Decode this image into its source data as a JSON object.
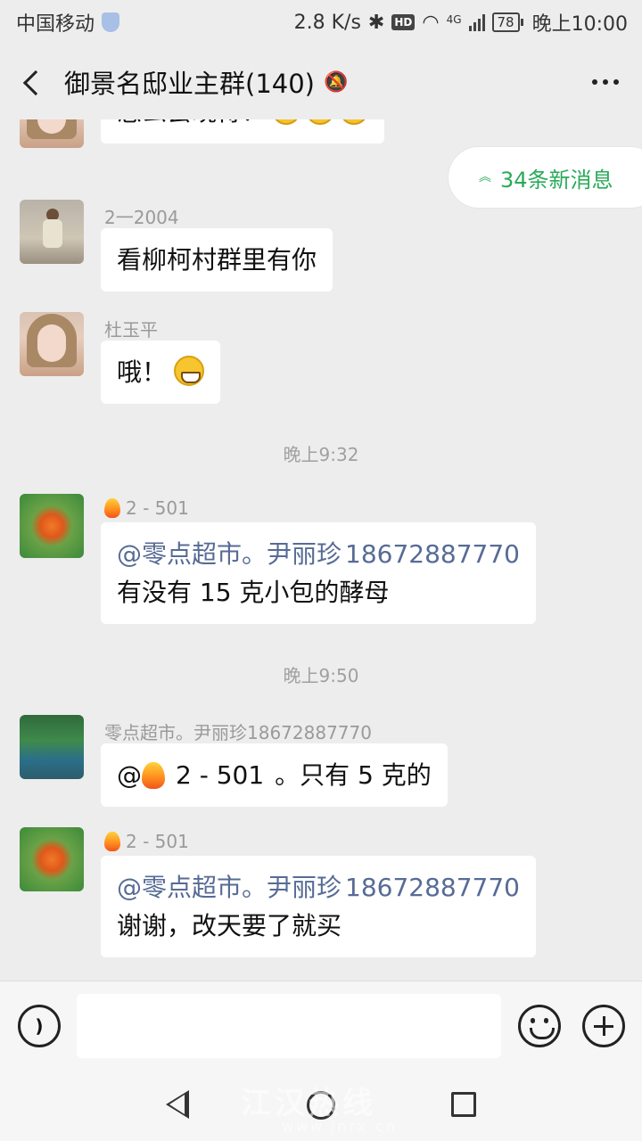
{
  "status_bar": {
    "carrier": "中国移动",
    "net_speed": "2.8 K/s",
    "hd": "HD",
    "network": "4G",
    "battery": "78",
    "time": "晚上10:00"
  },
  "header": {
    "title": "御景名邸业主群(140)",
    "icons": [
      "back-icon",
      "mute-bell-icon",
      "more-icon"
    ]
  },
  "new_messages_pill": {
    "label": "34条新消息"
  },
  "messages": [
    {
      "sender": "",
      "text": "怎么会晓得？",
      "emoji": "surprised-emoji"
    },
    {
      "sender": "2一2004",
      "text": "看柳柯村群里有你"
    },
    {
      "sender": "杜玉平",
      "text": "哦！",
      "emoji": "grin-emoji"
    },
    {
      "sender": "2 - 501",
      "mention": "@零点超市。尹丽珍",
      "phone": "18672887770",
      "text": "有没有 15 克小包的酵母"
    },
    {
      "sender": "零点超市。尹丽珍18672887770",
      "text_prefix": "@",
      "mention_name": "2 - 501",
      "text": "。只有 5 克的"
    },
    {
      "sender": "2 - 501",
      "mention": "@零点超市。尹丽珍",
      "phone": "18672887770",
      "text": "谢谢，改天要了就买"
    }
  ],
  "timestamps": [
    "晚上9:32",
    "晚上9:50"
  ],
  "input_bar": {
    "value": ""
  },
  "watermark": {
    "text": "江汉热线",
    "url": "www.jnrx.cn"
  },
  "colors": {
    "accent_green": "#2aaa5a",
    "mention_blue": "#576b95",
    "background": "#ededed"
  }
}
